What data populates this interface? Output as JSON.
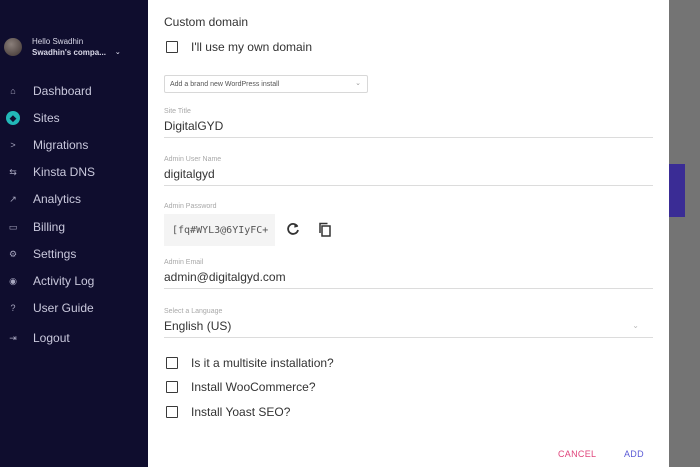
{
  "profile": {
    "greeting": "Hello Swadhin",
    "company": "Swadhin's compa...",
    "chevron": "⌄"
  },
  "sidebar": {
    "items": [
      {
        "label": "Dashboard",
        "icon": "home-icon",
        "glyph": "⌂"
      },
      {
        "label": "Sites",
        "icon": "sites-icon",
        "glyph": "◆"
      },
      {
        "label": "Migrations",
        "icon": "migrations-icon",
        "glyph": ">"
      },
      {
        "label": "Kinsta DNS",
        "icon": "dns-icon",
        "glyph": "⇆"
      },
      {
        "label": "Analytics",
        "icon": "analytics-icon",
        "glyph": "↗"
      },
      {
        "label": "Billing",
        "icon": "billing-icon",
        "glyph": "▭"
      },
      {
        "label": "Settings",
        "icon": "settings-icon",
        "glyph": "⚙"
      },
      {
        "label": "Activity Log",
        "icon": "activity-icon",
        "glyph": "◉"
      },
      {
        "label": "User Guide",
        "icon": "guide-icon",
        "glyph": "?"
      },
      {
        "label": "Logout",
        "icon": "logout-icon",
        "glyph": "⇥"
      }
    ],
    "active_index": 1,
    "active_color": "#22b8b8"
  },
  "modal": {
    "title": "Custom domain",
    "own_domain_label": "I'll use my own domain",
    "install_select": "Add a brand new WordPress install",
    "site_title": {
      "label": "Site Title",
      "value": "DigitalGYD"
    },
    "admin_user": {
      "label": "Admin User Name",
      "value": "digitalgyd"
    },
    "admin_password": {
      "label": "Admin Password",
      "value": "[fq#WYL3@6YIyFC+"
    },
    "admin_email": {
      "label": "Admin Email",
      "value": "admin@digitalgyd.com"
    },
    "language": {
      "label": "Select a Language",
      "value": "English (US)"
    },
    "options": {
      "multisite": "Is it a multisite installation?",
      "woocommerce": "Install WooCommerce?",
      "yoast": "Install Yoast SEO?"
    },
    "cancel_label": "CANCEL",
    "add_label": "ADD"
  },
  "colors": {
    "cancel": "#e0457b",
    "add": "#5b5bd6",
    "sidebar_bg": "#0f0d2e"
  }
}
